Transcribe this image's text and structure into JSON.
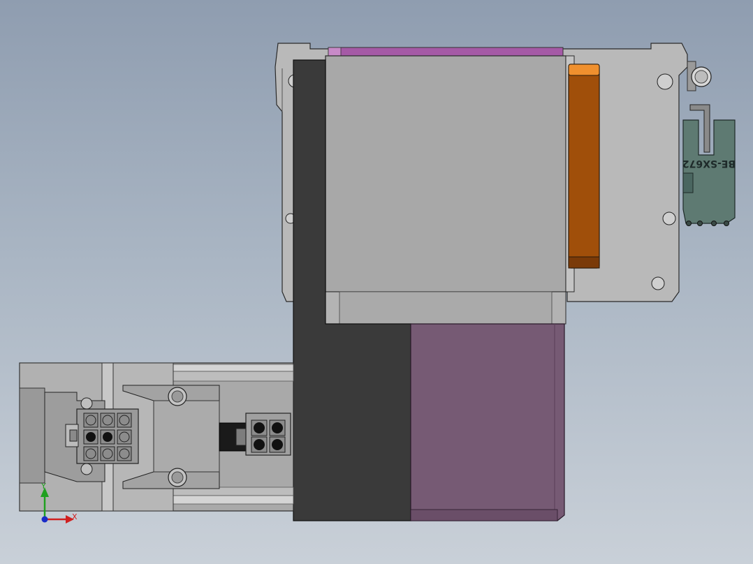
{
  "viewport": {
    "part_label": "BE-SX672",
    "triad": {
      "x_label": "X",
      "y_label": "Y"
    }
  },
  "colors": {
    "background_top": "#8f9db0",
    "background_bottom": "#c9d0d8",
    "housing_gray": "#a6a6a6",
    "dark_plate": "#3a3a3a",
    "purple_body": "#765a74",
    "magenta_strip": "#a55aa6",
    "orange_bar": "#a04f0a",
    "teal_board": "#5e7a72"
  }
}
